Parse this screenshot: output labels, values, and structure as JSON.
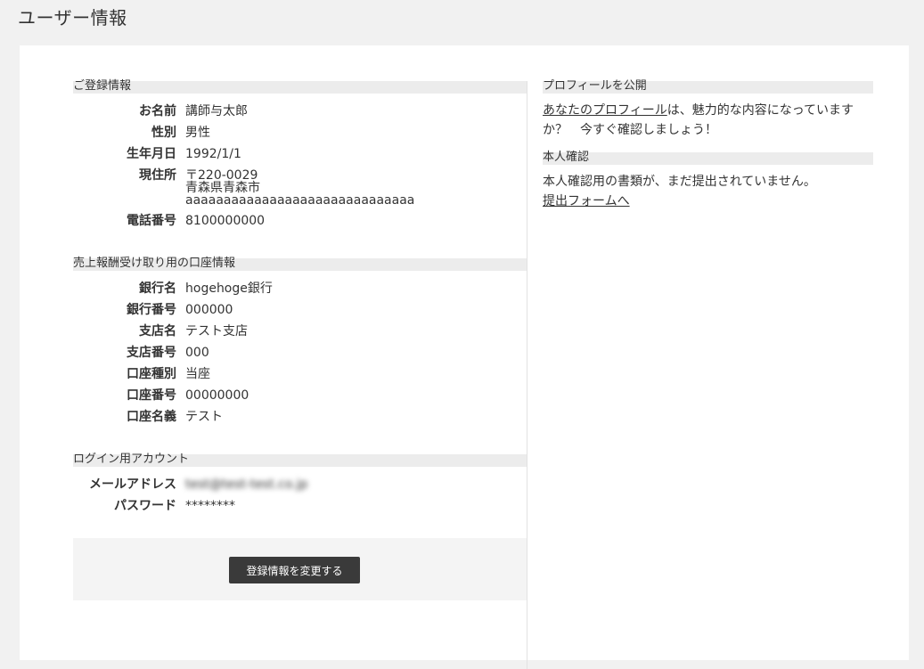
{
  "page": {
    "title": "ユーザー情報"
  },
  "registration": {
    "heading": "ご登録情報",
    "name_label": "お名前",
    "name_value": "講師与太郎",
    "gender_label": "性別",
    "gender_value": "男性",
    "birthday_label": "生年月日",
    "birthday_value": "1992/1/1",
    "address_label": "現住所",
    "address_postal": "〒220-0029",
    "address_pref_city": "青森県青森市",
    "address_line": "aaaaaaaaaaaaaaaaaaaaaaaaaaaaaa",
    "phone_label": "電話番号",
    "phone_value": "8100000000"
  },
  "bank": {
    "heading": "売上報酬受け取り用の口座情報",
    "bank_name_label": "銀行名",
    "bank_name_value": "hogehoge銀行",
    "bank_code_label": "銀行番号",
    "bank_code_value": "000000",
    "branch_name_label": "支店名",
    "branch_name_value": "テスト支店",
    "branch_code_label": "支店番号",
    "branch_code_value": "000",
    "account_type_label": "口座種別",
    "account_type_value": "当座",
    "account_number_label": "口座番号",
    "account_number_value": "00000000",
    "account_holder_label": "口座名義",
    "account_holder_value": "テスト"
  },
  "login": {
    "heading": "ログイン用アカウント",
    "email_label": "メールアドレス",
    "email_value": "test@test-test.co.jp",
    "password_label": "パスワード",
    "password_value": "********"
  },
  "actions": {
    "edit_button": "登録情報を変更する"
  },
  "profile": {
    "heading": "プロフィールを公開",
    "link_text": "あなたのプロフィール",
    "text_after": "は、魅力的な内容になっていますか？　今すぐ確認しましょう！"
  },
  "identity": {
    "heading": "本人確認",
    "text": "本人確認用の書類が、まだ提出されていません。",
    "link_text": "提出フォームへ"
  }
}
